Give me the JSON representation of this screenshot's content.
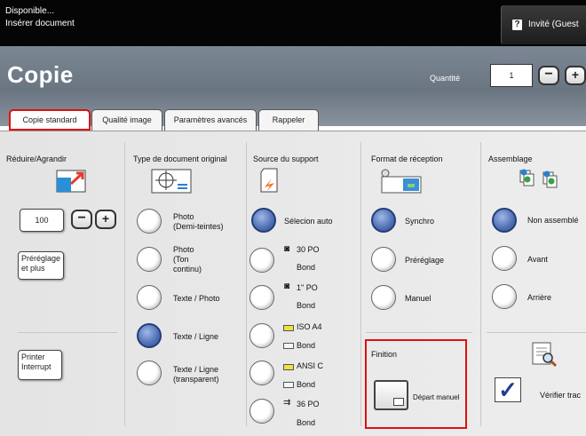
{
  "status": {
    "line1": "Disponible...",
    "line2": "Insérer document"
  },
  "guest": {
    "icon": "help-icon",
    "icon_text": "?",
    "label": "Invité (Guest"
  },
  "header": {
    "title": "Copie",
    "quantity_label": "Quantité",
    "quantity_value": "1",
    "minus": "−",
    "plus": "+"
  },
  "tabs": [
    "Copie standard",
    "Qualité image",
    "Paramètres avancés",
    "Rappeler"
  ],
  "reduce": {
    "title": "Réduire/Agrandir",
    "value": "100",
    "minus": "−",
    "plus": "+",
    "preset_line1": "Préréglage",
    "preset_line2": "et plus",
    "printer_line1": "Printer",
    "printer_line2": "Interrupt"
  },
  "doc_type": {
    "title": "Type de document original",
    "options": [
      {
        "l1": "Photo",
        "l2": "(Demi-teintes)"
      },
      {
        "l1": "Photo",
        "l2": "(Ton",
        "l3": "continu)"
      },
      {
        "l1": "Texte / Photo"
      },
      {
        "l1": "Texte / Ligne"
      },
      {
        "l1": "Texte / Ligne",
        "l2": "(transparent)"
      }
    ]
  },
  "source": {
    "title": "Source du support",
    "options": [
      {
        "l1": "Sélecion auto"
      },
      {
        "l1": "30 PO",
        "l2": "Bond"
      },
      {
        "l1": "1\" PO",
        "l2": "Bond"
      },
      {
        "l1": "ISO A4",
        "l2": "Bond"
      },
      {
        "l1": "ANSI C",
        "l2": "Bond"
      },
      {
        "l1": "36 PO",
        "l2": "Bond"
      }
    ]
  },
  "output": {
    "title": "Format de réception",
    "options": [
      "Synchro",
      "Préréglage",
      "Manuel"
    ]
  },
  "finition": {
    "title": "Finition",
    "button": "Départ manuel"
  },
  "assemblage": {
    "title": "Assemblage",
    "options": [
      "Non assemblé",
      "Avant",
      "Arrière"
    ],
    "verify": "Vérifier trac"
  },
  "colors": {
    "accent": "#4f6fb4",
    "highlight": "#e01010",
    "header_bg": "#737e8b"
  }
}
